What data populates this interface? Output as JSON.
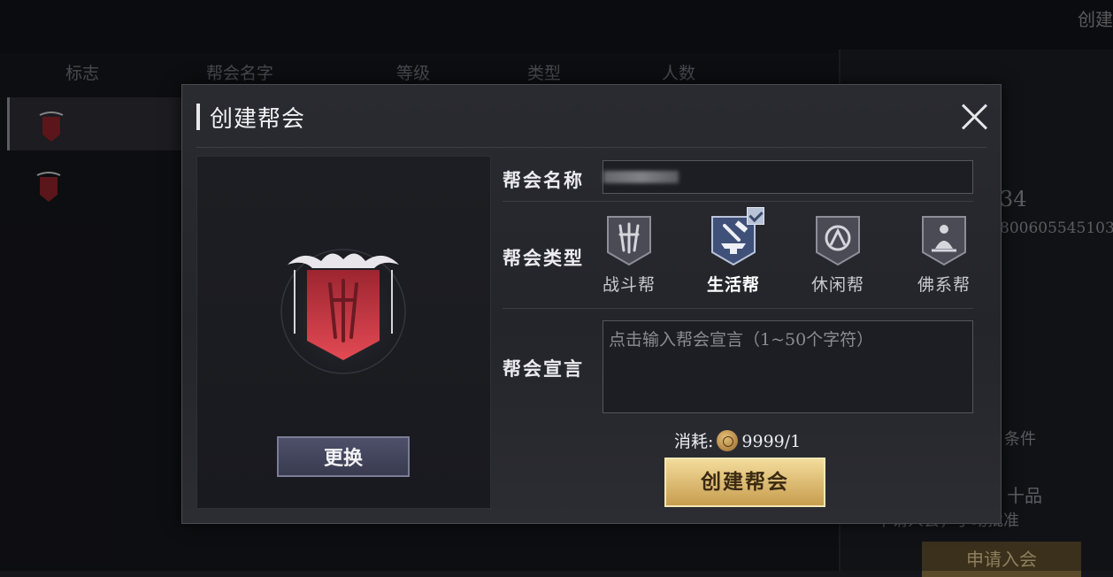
{
  "background": {
    "create_label": "创建",
    "headers": [
      "标志",
      "帮会名字",
      "等级",
      "类型",
      "人数"
    ],
    "right_panel": {
      "level_text": "34",
      "id_text": "800605545103",
      "condition_text": "条件",
      "grade_text": "十品",
      "approve_text": "申请人会，手动批准",
      "apply_button": "申请入会"
    }
  },
  "dialog": {
    "title": "创建帮会",
    "change_button": "更换",
    "name_label": "帮会名称",
    "type_label": "帮会类型",
    "types": [
      {
        "label": "战斗帮",
        "icon": "swords-banner-icon",
        "selected": false
      },
      {
        "label": "生活帮",
        "icon": "anvil-banner-icon",
        "selected": true
      },
      {
        "label": "休闲帮",
        "icon": "leisure-banner-icon",
        "selected": false
      },
      {
        "label": "佛系帮",
        "icon": "meditation-banner-icon",
        "selected": false
      }
    ],
    "declaration_label": "帮会宣言",
    "declaration_placeholder": "点击输入帮会宣言（1~50个字符）",
    "cost_label": "消耗:",
    "cost_value": "9999/1",
    "create_button": "创建帮会"
  },
  "colors": {
    "accent_gold": "#e3c57f",
    "emblem_red": "#c8323c",
    "button_purple": "#44475e"
  }
}
